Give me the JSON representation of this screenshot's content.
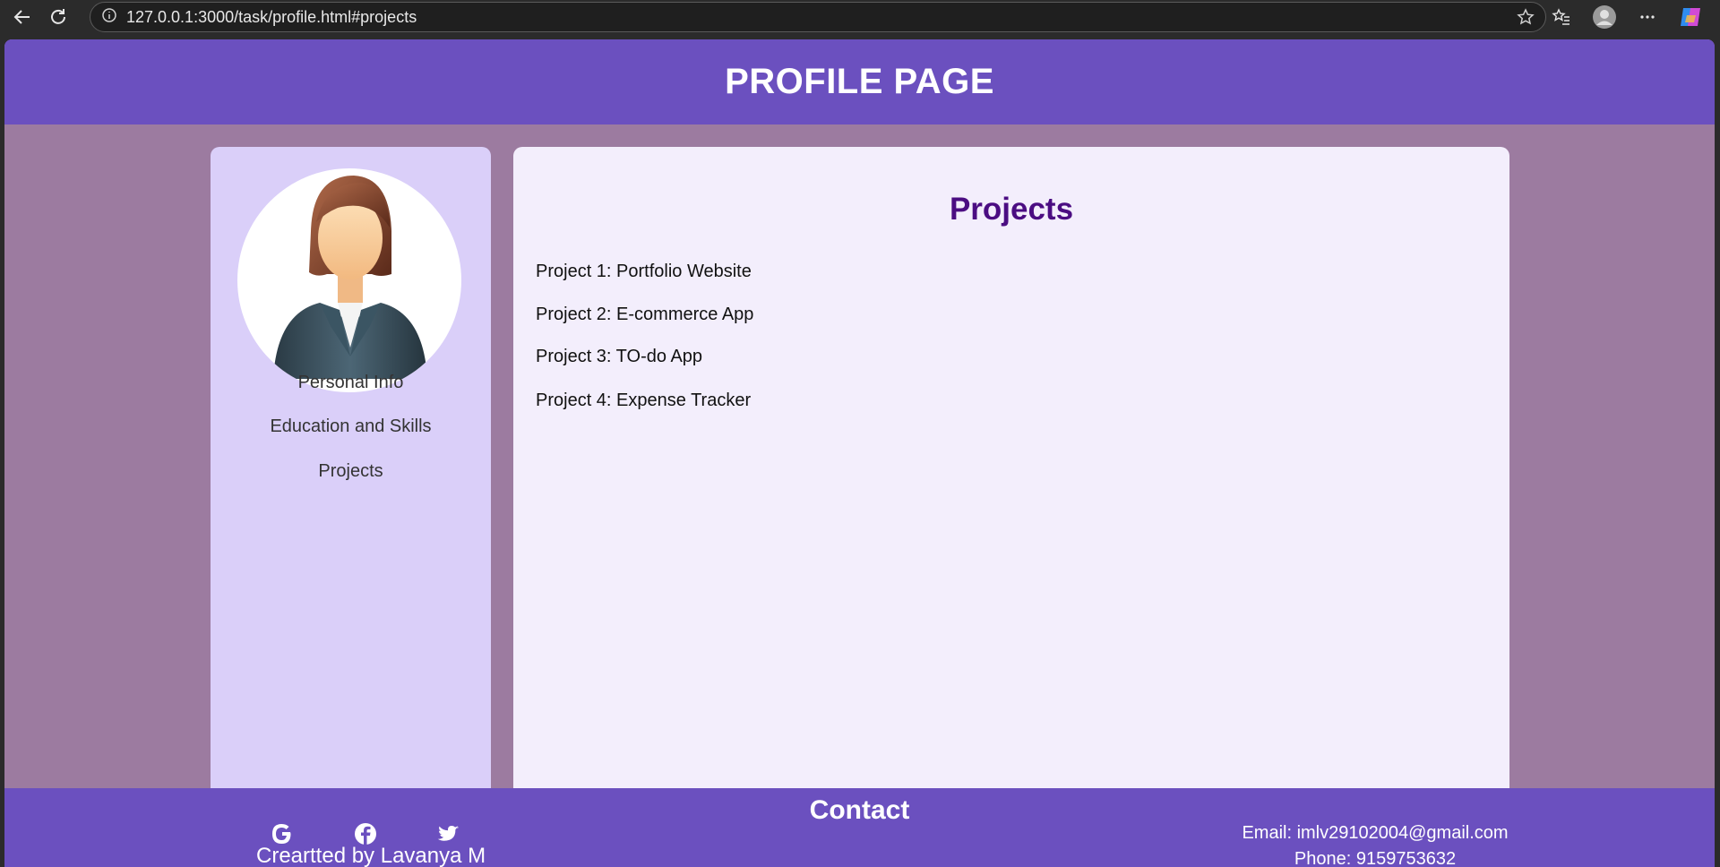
{
  "browser": {
    "url": "127.0.0.1:3000/task/profile.html#projects",
    "icons": [
      "back-arrow-icon",
      "reload-icon",
      "info-icon",
      "star-icon",
      "favorites-icon",
      "profile-icon",
      "more-icon",
      "copilot-icon"
    ]
  },
  "header": {
    "title": "PROFILE PAGE"
  },
  "sidebar": {
    "items": [
      {
        "label": "Personal Info"
      },
      {
        "label": "Education and Skills"
      },
      {
        "label": "Projects"
      }
    ]
  },
  "main": {
    "heading": "Projects",
    "projects": [
      {
        "label": "Project 1: Portfolio Website"
      },
      {
        "label": "Project 2: E-commerce App"
      },
      {
        "label": "Project 3: TO-do App"
      },
      {
        "label": "Project 4: Expense Tracker"
      }
    ]
  },
  "footer": {
    "title": "Contact",
    "credit": "Creartted by Lavanya M",
    "email": "Email: imlv29102004@gmail.com",
    "phone": "Phone: 9159753632",
    "social_icons": [
      "google-icon",
      "facebook-icon",
      "twitter-icon"
    ]
  },
  "colors": {
    "header_bg": "#6b50bf",
    "page_bg": "#9c7ba0",
    "sidebar_bg": "#dacff9",
    "content_bg": "#f3eefc",
    "heading_color": "#4b0d82"
  }
}
